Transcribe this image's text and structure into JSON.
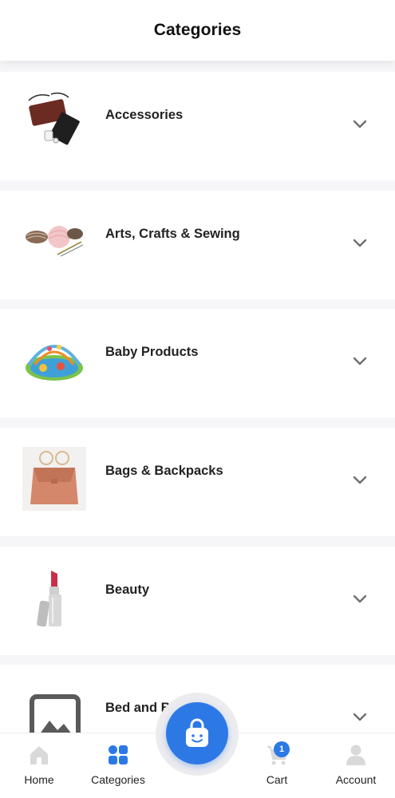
{
  "header": {
    "title": "Categories"
  },
  "categories": [
    {
      "label": "Accessories",
      "icon": "accessories-image"
    },
    {
      "label": "Arts, Crafts & Sewing",
      "icon": "yarn-image"
    },
    {
      "label": "Baby Products",
      "icon": "baby-playmat-image"
    },
    {
      "label": "Bags & Backpacks",
      "icon": "handbag-image"
    },
    {
      "label": "Beauty",
      "icon": "lipstick-image"
    },
    {
      "label": "Bed and Bath",
      "icon": "image-placeholder"
    }
  ],
  "tabbar": {
    "home": "Home",
    "categories": "Categories",
    "cart": "Cart",
    "account": "Account",
    "cart_count": "1"
  },
  "colors": {
    "accent": "#2c79e6",
    "inactive_icon": "#d9d9d9",
    "chevron": "#6f6f6f"
  }
}
